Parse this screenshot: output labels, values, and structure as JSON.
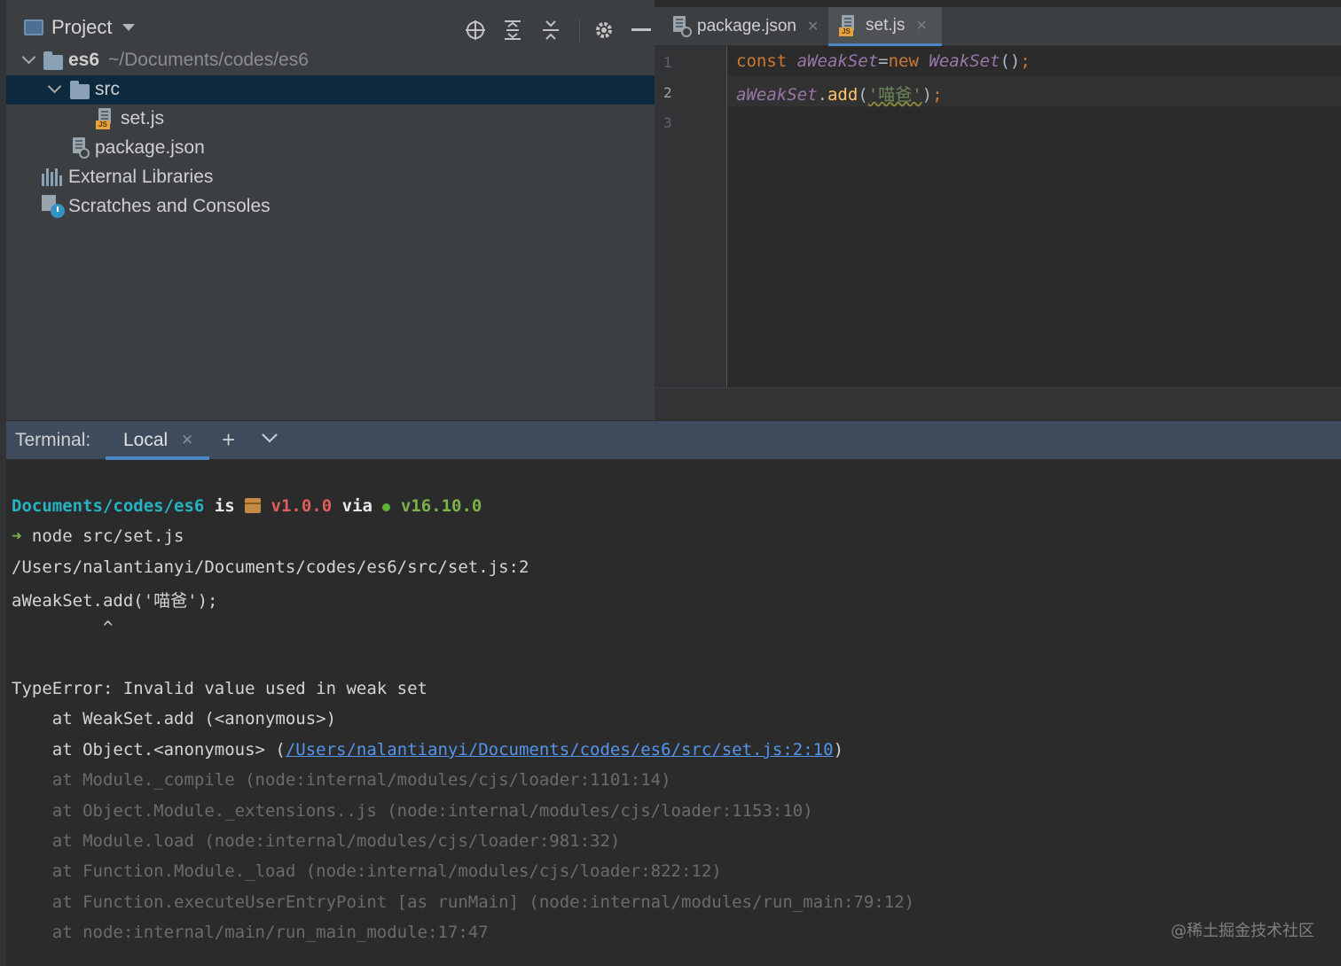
{
  "project_panel": {
    "title": "Project",
    "tree": [
      {
        "label": "es6",
        "path": "~/Documents/codes/es6"
      },
      {
        "label": "src"
      },
      {
        "label": "set.js"
      },
      {
        "label": "package.json"
      },
      {
        "label": "External Libraries"
      },
      {
        "label": "Scratches and Consoles"
      }
    ]
  },
  "editor": {
    "tabs": [
      {
        "label": "package.json",
        "close": "✕"
      },
      {
        "label": "set.js",
        "close": "✕"
      }
    ],
    "line_numbers": [
      "1",
      "2",
      "3"
    ],
    "code": {
      "l1_kw": "const ",
      "l1_var": "aWeakSet",
      "l1_eq": "=",
      "l1_new": "new ",
      "l1_cls": "WeakSet",
      "l1_paren": "()",
      "l1_semi": ";",
      "l2_var": "aWeakSet",
      "l2_dot": ".",
      "l2_fn": "add",
      "l2_open": "(",
      "l2_str": "'喵爸'",
      "l2_close": ")",
      "l2_semi": ";"
    }
  },
  "terminal": {
    "label": "Terminal:",
    "tab_label": "Local",
    "tab_close": "✕",
    "plus": "+",
    "prompt": {
      "dir": "Documents/codes/es6",
      "is": " is ",
      "version": " v1.0.0",
      "via": " via ",
      "node_version": " v16.10.0"
    },
    "arrow": "➜",
    "command": " node src/set.js",
    "lines": [
      "/Users/nalantianyi/Documents/codes/es6/src/set.js:2",
      "aWeakSet.add('喵爸');",
      "         ^",
      "TypeError: Invalid value used in weak set",
      "    at WeakSet.add (<anonymous>)"
    ],
    "obj_prefix": "    at Object.<anonymous> (",
    "obj_link": "/Users/nalantianyi/Documents/codes/es6/src/set.js:2:10",
    "obj_suffix": ")",
    "dim_lines": [
      "    at Module._compile (node:internal/modules/cjs/loader:1101:14)",
      "    at Object.Module._extensions..js (node:internal/modules/cjs/loader:1153:10)",
      "    at Module.load (node:internal/modules/cjs/loader:981:32)",
      "    at Function.Module._load (node:internal/modules/cjs/loader:822:12)",
      "    at Function.executeUserEntryPoint [as runMain] (node:internal/modules/run_main:79:12)",
      "    at node:internal/main/run_main_module:17:47"
    ]
  },
  "watermark": "@稀土掘金技术社区"
}
